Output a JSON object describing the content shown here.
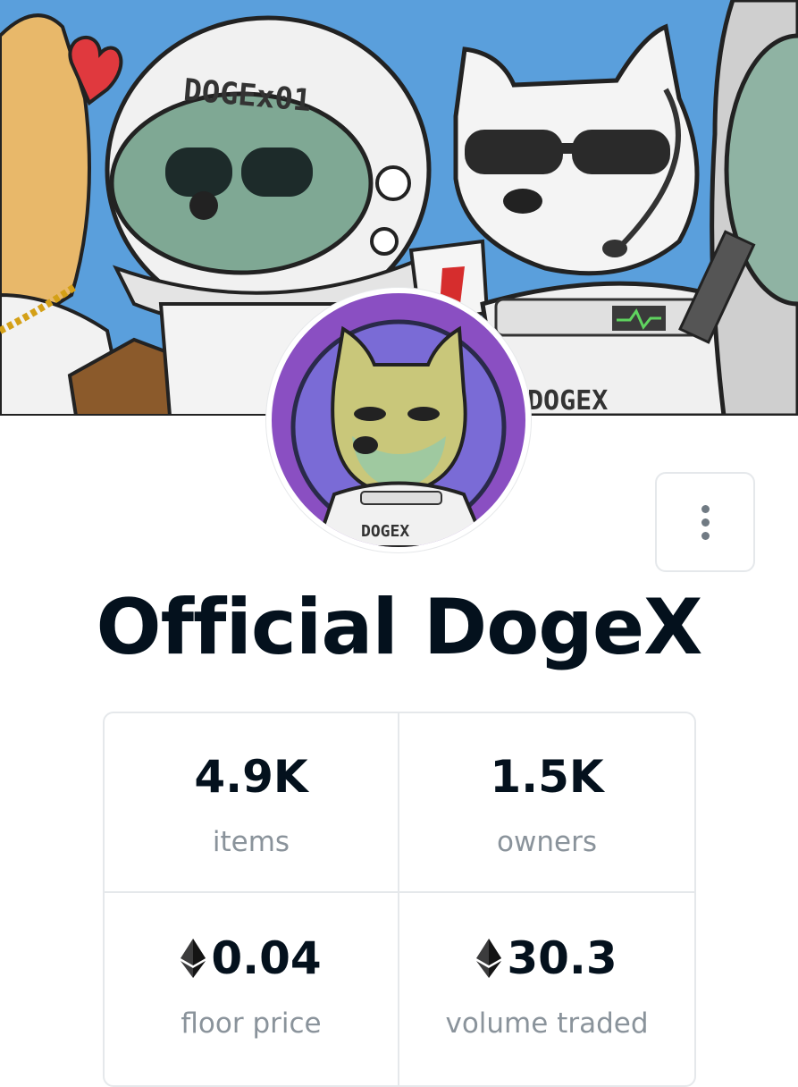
{
  "banner": {
    "helmet_text": "DOGEx01",
    "suit_text": "DOGEX"
  },
  "avatar": {
    "suit_text": "DOGEX"
  },
  "collection": {
    "title": "Official DogeX"
  },
  "menu": {
    "more_button": "more-options"
  },
  "stats": {
    "items": {
      "value": "4.9K",
      "label": "items"
    },
    "owners": {
      "value": "1.5K",
      "label": "owners"
    },
    "floor_price": {
      "value": "0.04",
      "label": "floor price",
      "currency_icon": "ethereum-icon"
    },
    "volume_traded": {
      "value": "30.3",
      "label": "volume traded",
      "currency_icon": "ethereum-icon"
    }
  },
  "colors": {
    "title": "#04111d",
    "label": "#8a939b",
    "border": "#e5e8eb",
    "banner_sky": "#5a9fdc",
    "avatar_bg": "#8a4fc2"
  }
}
